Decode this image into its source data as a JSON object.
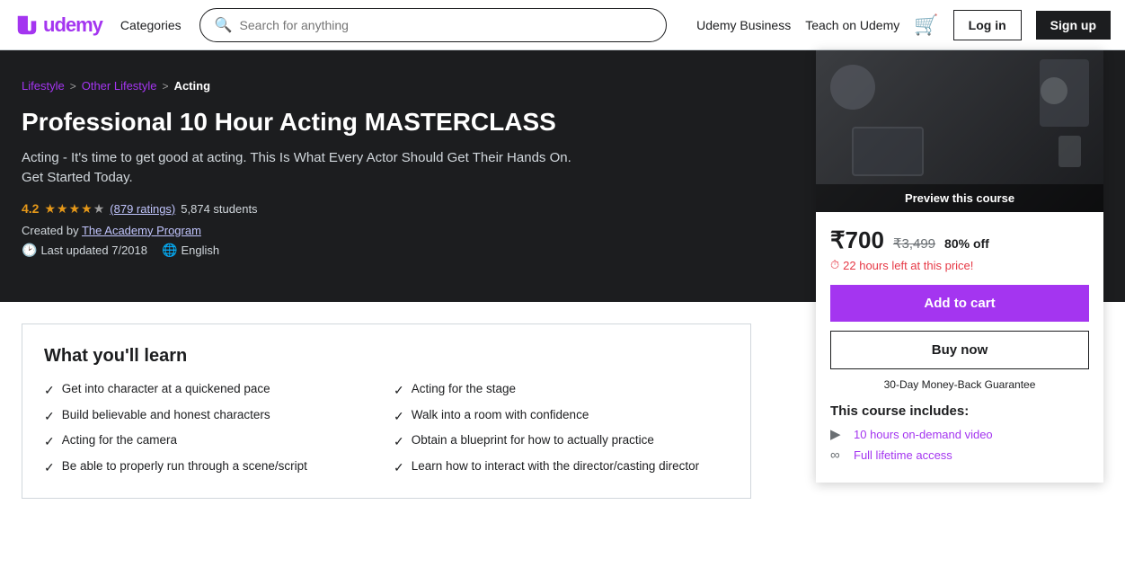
{
  "header": {
    "logo_text": "udemy",
    "categories_label": "Categories",
    "search_placeholder": "Search for anything",
    "nav_links": [
      "Udemy Business",
      "Teach on Udemy"
    ],
    "login_label": "Log in",
    "signup_label": "Sign up"
  },
  "breadcrumb": {
    "lifestyle": "Lifestyle",
    "other_lifestyle": "Other Lifestyle",
    "acting": "Acting",
    "sep": ">"
  },
  "course": {
    "title": "Professional 10 Hour Acting MASTERCLASS",
    "subtitle": "Acting - It's time to get good at acting. This Is What Every Actor Should Get Their Hands On. Get Started Today.",
    "rating": "4.2",
    "ratings_text": "(879 ratings)",
    "students": "5,874 students",
    "creator_prefix": "Created by",
    "creator": "The Academy Program",
    "last_updated_label": "Last updated 7/2018",
    "language": "English",
    "preview_label": "Preview this course"
  },
  "pricing": {
    "currency_symbol": "₹",
    "current_price": "700",
    "original_price": "₹3,499",
    "discount": "80% off",
    "urgency": "22 hours left at this price!",
    "add_to_cart": "Add to cart",
    "buy_now": "Buy now",
    "guarantee": "30-Day Money-Back Guarantee"
  },
  "includes": {
    "title": "This course includes:",
    "items": [
      {
        "icon": "video",
        "text": "10 hours on-demand video",
        "is_link": true
      },
      {
        "icon": "infinity",
        "text": "Full lifetime access",
        "is_link": true
      }
    ]
  },
  "learn": {
    "title": "What you'll learn",
    "items": [
      "Get into character at a quickened pace",
      "Acting for the stage",
      "Build believable and honest characters",
      "Walk into a room with confidence",
      "Acting for the camera",
      "Obtain a blueprint for how to actually practice",
      "Be able to properly run through a scene/script",
      "Learn how to interact with the director/casting director"
    ]
  }
}
